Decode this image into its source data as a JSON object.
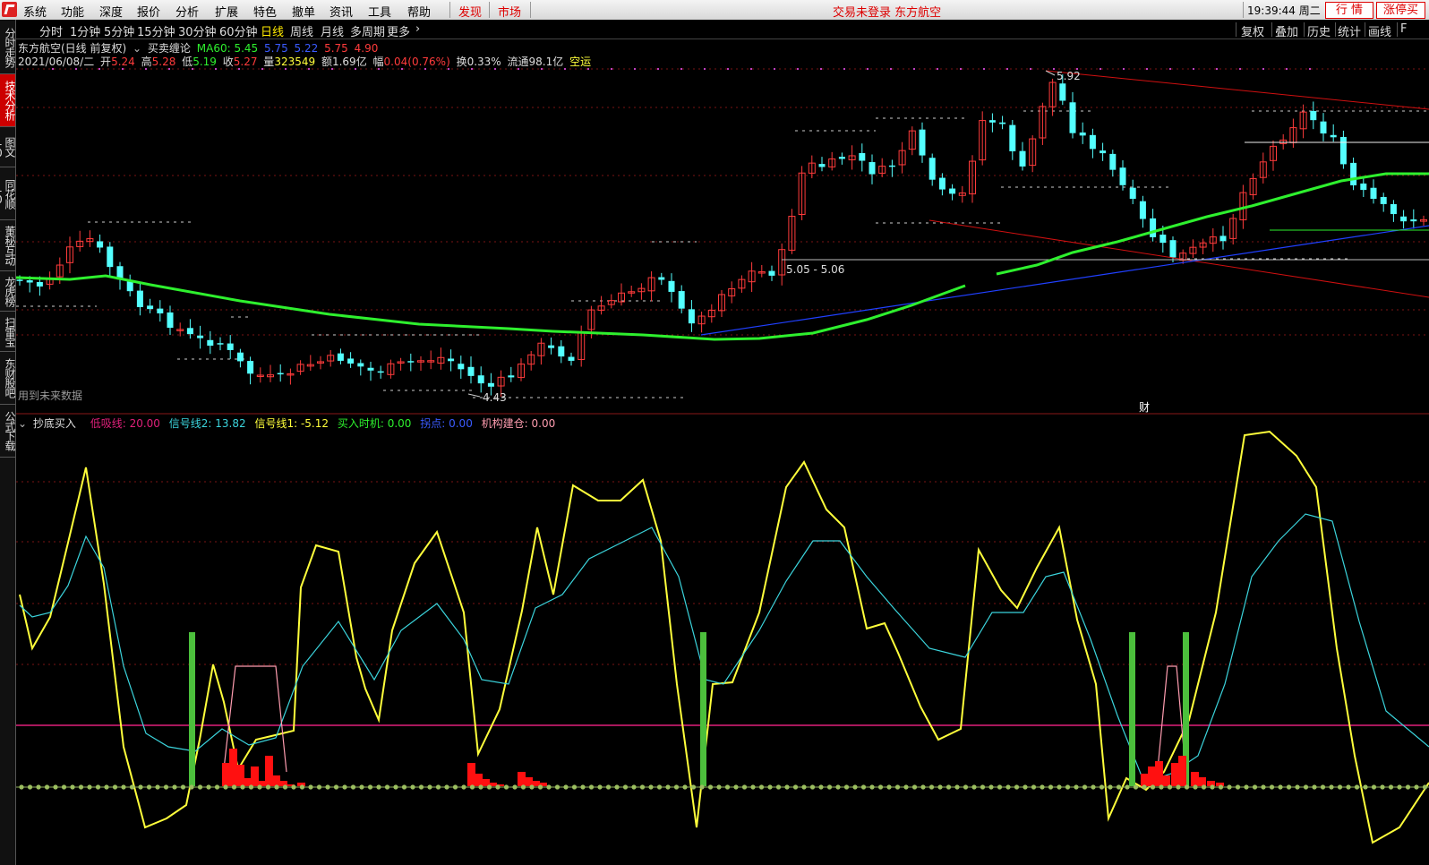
{
  "menubar": {
    "items": [
      "系统",
      "功能",
      "深度",
      "报价",
      "分析",
      "扩展",
      "特色",
      "撤单",
      "资讯",
      "工具",
      "帮助"
    ],
    "discover": "发现",
    "market": "市场",
    "status": "交易未登录  东方航空",
    "clock": "19:39:44 周二",
    "btn_quote": "行  情",
    "btn_limitup": "涨停买"
  },
  "sidebar": {
    "tabs": [
      {
        "label": "分时走势",
        "active": false
      },
      {
        "label": "技术分析",
        "active": true
      },
      {
        "label": "图文10",
        "active": false
      },
      {
        "label": "同花顺10",
        "active": false
      },
      {
        "label": "董秘互动",
        "active": false
      },
      {
        "label": "龙虎榜",
        "active": false
      },
      {
        "label": "扫雷宝",
        "active": false
      },
      {
        "label": "东财股吧",
        "active": false
      },
      {
        "label": "公式下载",
        "active": false
      }
    ]
  },
  "periods": {
    "items": [
      "分时",
      "1分钟",
      "5分钟",
      "15分钟",
      "30分钟",
      "60分钟",
      "日线",
      "周线",
      "月线",
      "多周期",
      "更多"
    ],
    "active": "日线"
  },
  "toolbar": {
    "items": [
      "复权",
      "叠加",
      "历史",
      "统计",
      "画线",
      "F"
    ]
  },
  "info": {
    "title": "东方航空(日线 前复权)",
    "indicator": "买卖缠论",
    "ma60": "MA60: 5.45",
    "v1": "5.75",
    "v2": "5.22",
    "v3": "5.75",
    "v4": "4.90",
    "date": "2021/06/08/二",
    "open_l": "开",
    "open": "5.24",
    "high_l": "高",
    "high": "5.28",
    "low_l": "低",
    "low": "5.19",
    "close_l": "收",
    "close": "5.27",
    "vol_l": "量",
    "vol": "323549",
    "amt_l": "额",
    "amt": "1.69亿",
    "chg_l": "幅",
    "chg": "0.04(0.76%)",
    "turn": "换0.33%",
    "float": "流通98.1亿",
    "tag": "空运"
  },
  "price_chart": {
    "high_label": "5.92",
    "low_label": "4.43",
    "range_label": "5.05 - 5.06",
    "future_hint": "用到未来数据",
    "cai_marker": "财"
  },
  "indicator_panel": {
    "name": "抄底买入",
    "low_line": "低吸线: 20.00",
    "signal2": "信号线2: 13.82",
    "signal1": "信号线1: -5.12",
    "buy_time": "买入时机: 0.00",
    "point": "拐点: 0.00",
    "inst": "机构建仓: 0.00"
  },
  "colors": {
    "up": "#ff3b3b",
    "down": "#54ffff",
    "ma": "#2ef02e",
    "signal1": "#ffff3b",
    "signal2": "#3bd4dc",
    "lowline": "#e0207a",
    "buy": "#4cbf3c",
    "inst": "#ff1010",
    "pivot": "#ff9db0"
  }
}
